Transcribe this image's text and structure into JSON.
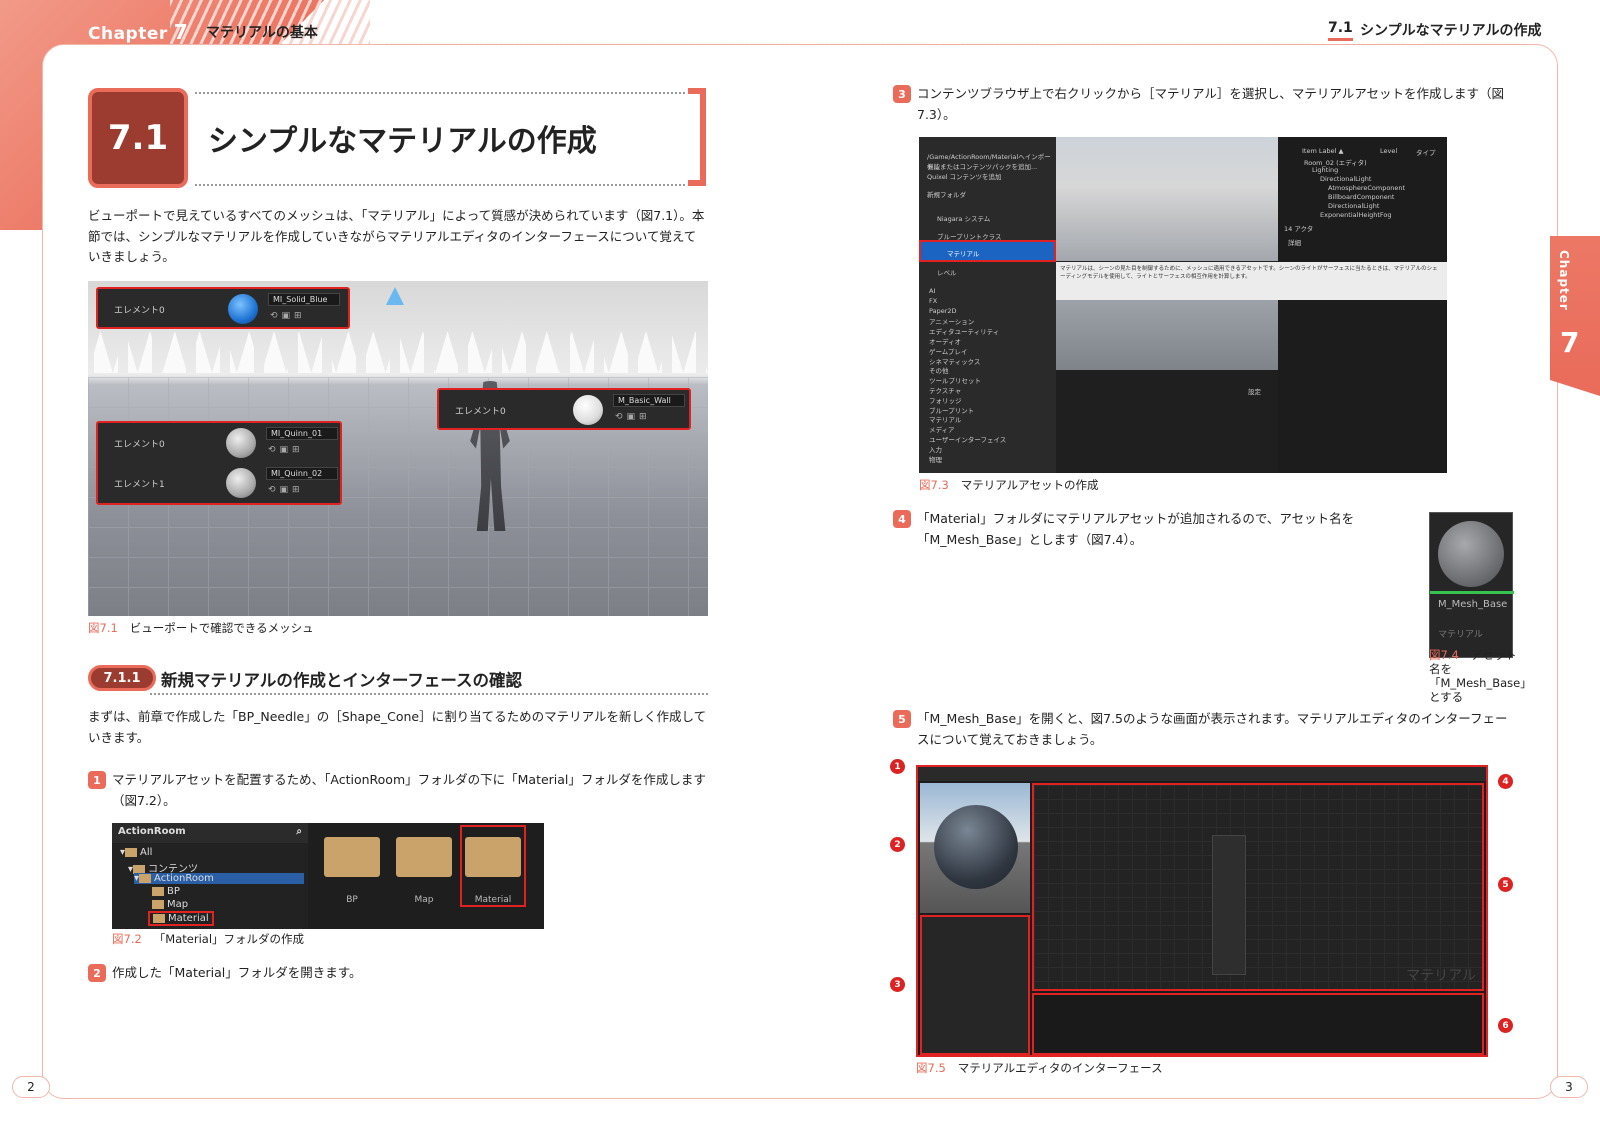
{
  "header": {
    "chapter_word": "Chapter",
    "chapter_num": "7",
    "chapter_title": "マテリアルの基本",
    "right_section_num": "7.1",
    "right_section_title": "シンプルなマテリアルの作成"
  },
  "side_tab": {
    "word": "Chapter",
    "num": "7"
  },
  "section": {
    "num": "7.1",
    "title": "シンプルなマテリアルの作成"
  },
  "intro": "ビューポートで見えているすべてのメッシュは、「マテリアル」によって質感が決められています（図7.1）。本節では、シンプルなマテリアルを作成していきながらマテリアルエディタのインターフェースについて覚えていきましょう。",
  "fig71": {
    "num": "図7.1",
    "caption": "ビューポートで確認できるメッシュ",
    "panels": {
      "top": {
        "label": "エレメント0",
        "material": "MI_Solid_Blue"
      },
      "right": {
        "label": "エレメント0",
        "material": "M_Basic_Wall"
      },
      "left0": {
        "label": "エレメント0",
        "material": "MI_Quinn_01"
      },
      "left1": {
        "label": "エレメント1",
        "material": "MI_Quinn_02"
      }
    }
  },
  "subsection": {
    "num": "7.1.1",
    "title": "新規マテリアルの作成とインターフェースの確認"
  },
  "sub_intro": "まずは、前章で作成した「BP_Needle」の［Shape_Cone］に割り当てるためのマテリアルを新しく作成していきます。",
  "steps": [
    {
      "n": "1",
      "text": "マテリアルアセットを配置するため、「ActionRoom」フォルダの下に「Material」フォルダを作成します（図7.2）。"
    },
    {
      "n": "2",
      "text": "作成した「Material」フォルダを開きます。"
    },
    {
      "n": "3",
      "text": "コンテンツブラウザ上で右クリックから［マテリアル］を選択し、マテリアルアセットを作成します（図7.3）。"
    },
    {
      "n": "4",
      "text": "「Material」フォルダにマテリアルアセットが追加されるので、アセット名を「M_Mesh_Base」とします（図7.4）。"
    },
    {
      "n": "5",
      "text": "「M_Mesh_Base」を開くと、図7.5のような画面が表示されます。マテリアルエディタのインターフェースについて覚えておきましょう。"
    }
  ],
  "fig72": {
    "num": "図7.2",
    "caption": "「Material」フォルダの作成",
    "tree_header": "ActionRoom",
    "tree": [
      "All",
      "コンテンツ",
      "ActionRoom",
      "BP",
      "Map",
      "Material"
    ],
    "folders": [
      "BP",
      "Map",
      "Material"
    ]
  },
  "fig73": {
    "num": "図7.3",
    "caption": "マテリアルアセットの作成",
    "menu_top": [
      "/Game/ActionRoom/Materialへインポート...",
      "機能またはコンテンツパックを追加...",
      "Quixel コンテンツを追加",
      "新規フォルダ",
      "Niagara システム",
      "ブループリントクラス"
    ],
    "menu_selected": "マテリアル",
    "menu_after": "レベル",
    "menu_list": [
      "AI",
      "FX",
      "Paper2D",
      "アニメーション",
      "エディタユーティリティ",
      "オーディオ",
      "ゲームプレイ",
      "シネマティックス",
      "その他",
      "ツールプリセット",
      "テクスチャ",
      "フォリッジ",
      "ブループリント",
      "マテリアル",
      "メディア",
      "ユーザーインターフェイス",
      "入力",
      "物理"
    ],
    "tooltip": "マテリアルは、シーンの見た目を制御するために、メッシュに適用できるアセットです。シーンのライトがサーフェスに当たるときは、マテリアルのシェーディングモデルを使用して、ライトとサーフェスの相互作用を計算します。",
    "outliner_header": [
      "Item Label ▲",
      "Level",
      "タイプ"
    ],
    "outliner_rows": [
      "Room_02 (エディタ)",
      "Lighting",
      "DirectionalLight",
      "AtmosphereComponent",
      "BillboardComponent",
      "DirectionalLight",
      "ExponentialHeightFog"
    ],
    "actor_count": "14 アクタ",
    "details_tab": "詳細",
    "settings": "設定"
  },
  "fig74": {
    "num": "図7.4",
    "caption": "アセット名を「M_Mesh_Base」とする",
    "asset_name": "M_Mesh_Base",
    "asset_type": "マテリアル"
  },
  "fig75": {
    "num": "図7.5",
    "caption": "マテリアルエディタのインターフェース",
    "graph_watermark": "マテリアル",
    "callouts": [
      "1",
      "2",
      "3",
      "4",
      "5",
      "6"
    ]
  },
  "pages": {
    "left": "2",
    "right": "3"
  },
  "colors": {
    "accent": "#ea6b5a",
    "dark_accent": "#9c3b2f",
    "highlight_red": "#e02222"
  }
}
